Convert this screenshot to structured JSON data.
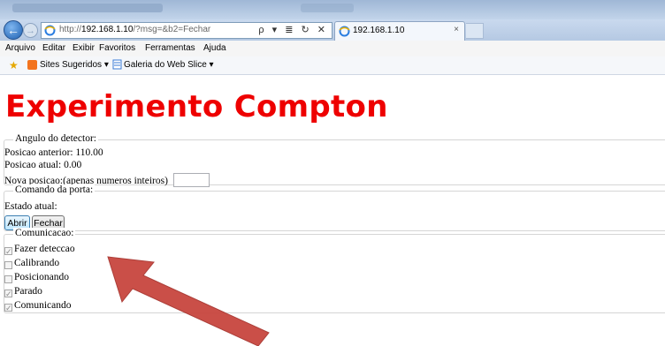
{
  "browser": {
    "address_prefix": "http://",
    "address_host": "192.168.1.10",
    "address_path": "/?msg=&b2=Fechar",
    "address_tools": "ρ ▾ ≣ ↻ ✕",
    "tab_title": "192.168.1.10",
    "tab_close": "×",
    "menu": [
      "Arquivo",
      "Editar",
      "Exibir",
      "Favoritos",
      "Ferramentas",
      "Ajuda"
    ],
    "favorites": {
      "suggested": "Sites Sugeridos ▾",
      "gallery": "Galeria do Web Slice ▾"
    }
  },
  "page": {
    "title": "Experimento Compton",
    "detector": {
      "legend": "Angulo do detector:",
      "previous": "Posicao anterior: 110.00",
      "current": "Posicao atual: 0.00",
      "new_label": "Nova posicao:(apenas numeros inteiros)",
      "new_value": ""
    },
    "door": {
      "legend": "Comando da porta:",
      "state": "Estado atual:",
      "open": "Abrir",
      "close": "Fechar"
    },
    "comm": {
      "legend": "Comunicacao:",
      "items": [
        {
          "label": "Fazer deteccao",
          "checked": true
        },
        {
          "label": "Calibrando",
          "checked": false
        },
        {
          "label": "Posicionando",
          "checked": false
        },
        {
          "label": "Parado",
          "checked": true
        },
        {
          "label": "Comunicando",
          "checked": true
        }
      ]
    }
  },
  "colors": {
    "title": "#ee0000",
    "arrow": "#c8463f"
  }
}
